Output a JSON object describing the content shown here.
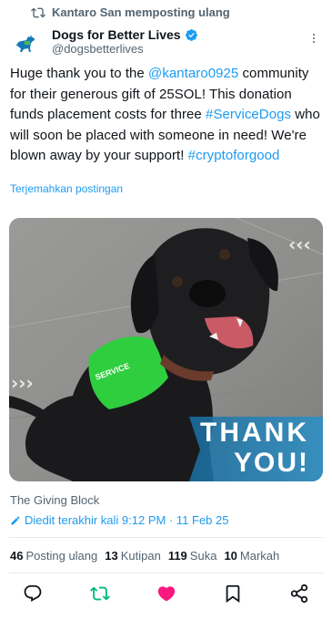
{
  "repost": {
    "icon": "repost-icon",
    "text": "Kantaro San memposting ulang"
  },
  "author": {
    "name": "Dogs for Better Lives",
    "handle": "@dogsbetterlives",
    "avatar_icon": "dog-logo-icon",
    "verified_icon": "verified-badge-icon"
  },
  "tweet": {
    "parts": [
      {
        "text": "Huge thank you to the ",
        "link": false
      },
      {
        "text": "@kantaro0925",
        "link": true
      },
      {
        "text": " community for their generous gift of 25SOL! This donation funds placement costs for three ",
        "link": false
      },
      {
        "text": "#ServiceDogs",
        "link": true
      },
      {
        "text": " who will soon be placed with someone in need! We're blown away by your support! ",
        "link": false
      },
      {
        "text": "#cryptoforgood",
        "link": true
      }
    ]
  },
  "translate_label": "Terjemahkan postingan",
  "media": {
    "overlay_line1": "THANK",
    "overlay_line2": "YOU!",
    "vest_text": "SERVICE"
  },
  "source": "The Giving Block",
  "edited": {
    "icon": "pencil-icon",
    "text": "Diedit terakhir kali 9:12 PM · 11 Feb 25"
  },
  "stats": [
    {
      "num": "46",
      "label": "Posting ulang"
    },
    {
      "num": "13",
      "label": "Kutipan"
    },
    {
      "num": "119",
      "label": "Suka"
    },
    {
      "num": "10",
      "label": "Markah"
    }
  ],
  "actions": [
    {
      "icon": "reply-icon"
    },
    {
      "icon": "repost-icon"
    },
    {
      "icon": "like-icon"
    },
    {
      "icon": "bookmark-icon"
    },
    {
      "icon": "share-icon"
    }
  ],
  "colors": {
    "link": "#1d9bf0",
    "repost_active": "#00ba7c",
    "like_active": "#f91880",
    "secondary": "#536471"
  }
}
